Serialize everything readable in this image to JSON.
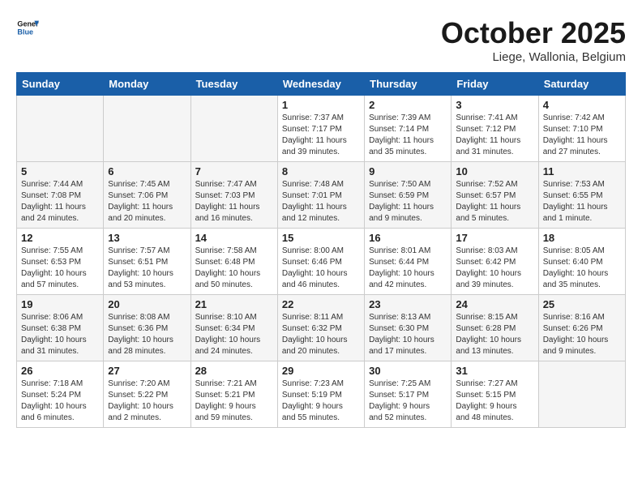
{
  "header": {
    "logo_general": "General",
    "logo_blue": "Blue",
    "month": "October 2025",
    "location": "Liege, Wallonia, Belgium"
  },
  "weekdays": [
    "Sunday",
    "Monday",
    "Tuesday",
    "Wednesday",
    "Thursday",
    "Friday",
    "Saturday"
  ],
  "weeks": [
    [
      {
        "day": "",
        "info": ""
      },
      {
        "day": "",
        "info": ""
      },
      {
        "day": "",
        "info": ""
      },
      {
        "day": "1",
        "info": "Sunrise: 7:37 AM\nSunset: 7:17 PM\nDaylight: 11 hours\nand 39 minutes."
      },
      {
        "day": "2",
        "info": "Sunrise: 7:39 AM\nSunset: 7:14 PM\nDaylight: 11 hours\nand 35 minutes."
      },
      {
        "day": "3",
        "info": "Sunrise: 7:41 AM\nSunset: 7:12 PM\nDaylight: 11 hours\nand 31 minutes."
      },
      {
        "day": "4",
        "info": "Sunrise: 7:42 AM\nSunset: 7:10 PM\nDaylight: 11 hours\nand 27 minutes."
      }
    ],
    [
      {
        "day": "5",
        "info": "Sunrise: 7:44 AM\nSunset: 7:08 PM\nDaylight: 11 hours\nand 24 minutes."
      },
      {
        "day": "6",
        "info": "Sunrise: 7:45 AM\nSunset: 7:06 PM\nDaylight: 11 hours\nand 20 minutes."
      },
      {
        "day": "7",
        "info": "Sunrise: 7:47 AM\nSunset: 7:03 PM\nDaylight: 11 hours\nand 16 minutes."
      },
      {
        "day": "8",
        "info": "Sunrise: 7:48 AM\nSunset: 7:01 PM\nDaylight: 11 hours\nand 12 minutes."
      },
      {
        "day": "9",
        "info": "Sunrise: 7:50 AM\nSunset: 6:59 PM\nDaylight: 11 hours\nand 9 minutes."
      },
      {
        "day": "10",
        "info": "Sunrise: 7:52 AM\nSunset: 6:57 PM\nDaylight: 11 hours\nand 5 minutes."
      },
      {
        "day": "11",
        "info": "Sunrise: 7:53 AM\nSunset: 6:55 PM\nDaylight: 11 hours\nand 1 minute."
      }
    ],
    [
      {
        "day": "12",
        "info": "Sunrise: 7:55 AM\nSunset: 6:53 PM\nDaylight: 10 hours\nand 57 minutes."
      },
      {
        "day": "13",
        "info": "Sunrise: 7:57 AM\nSunset: 6:51 PM\nDaylight: 10 hours\nand 53 minutes."
      },
      {
        "day": "14",
        "info": "Sunrise: 7:58 AM\nSunset: 6:48 PM\nDaylight: 10 hours\nand 50 minutes."
      },
      {
        "day": "15",
        "info": "Sunrise: 8:00 AM\nSunset: 6:46 PM\nDaylight: 10 hours\nand 46 minutes."
      },
      {
        "day": "16",
        "info": "Sunrise: 8:01 AM\nSunset: 6:44 PM\nDaylight: 10 hours\nand 42 minutes."
      },
      {
        "day": "17",
        "info": "Sunrise: 8:03 AM\nSunset: 6:42 PM\nDaylight: 10 hours\nand 39 minutes."
      },
      {
        "day": "18",
        "info": "Sunrise: 8:05 AM\nSunset: 6:40 PM\nDaylight: 10 hours\nand 35 minutes."
      }
    ],
    [
      {
        "day": "19",
        "info": "Sunrise: 8:06 AM\nSunset: 6:38 PM\nDaylight: 10 hours\nand 31 minutes."
      },
      {
        "day": "20",
        "info": "Sunrise: 8:08 AM\nSunset: 6:36 PM\nDaylight: 10 hours\nand 28 minutes."
      },
      {
        "day": "21",
        "info": "Sunrise: 8:10 AM\nSunset: 6:34 PM\nDaylight: 10 hours\nand 24 minutes."
      },
      {
        "day": "22",
        "info": "Sunrise: 8:11 AM\nSunset: 6:32 PM\nDaylight: 10 hours\nand 20 minutes."
      },
      {
        "day": "23",
        "info": "Sunrise: 8:13 AM\nSunset: 6:30 PM\nDaylight: 10 hours\nand 17 minutes."
      },
      {
        "day": "24",
        "info": "Sunrise: 8:15 AM\nSunset: 6:28 PM\nDaylight: 10 hours\nand 13 minutes."
      },
      {
        "day": "25",
        "info": "Sunrise: 8:16 AM\nSunset: 6:26 PM\nDaylight: 10 hours\nand 9 minutes."
      }
    ],
    [
      {
        "day": "26",
        "info": "Sunrise: 7:18 AM\nSunset: 5:24 PM\nDaylight: 10 hours\nand 6 minutes."
      },
      {
        "day": "27",
        "info": "Sunrise: 7:20 AM\nSunset: 5:22 PM\nDaylight: 10 hours\nand 2 minutes."
      },
      {
        "day": "28",
        "info": "Sunrise: 7:21 AM\nSunset: 5:21 PM\nDaylight: 9 hours\nand 59 minutes."
      },
      {
        "day": "29",
        "info": "Sunrise: 7:23 AM\nSunset: 5:19 PM\nDaylight: 9 hours\nand 55 minutes."
      },
      {
        "day": "30",
        "info": "Sunrise: 7:25 AM\nSunset: 5:17 PM\nDaylight: 9 hours\nand 52 minutes."
      },
      {
        "day": "31",
        "info": "Sunrise: 7:27 AM\nSunset: 5:15 PM\nDaylight: 9 hours\nand 48 minutes."
      },
      {
        "day": "",
        "info": ""
      }
    ]
  ]
}
